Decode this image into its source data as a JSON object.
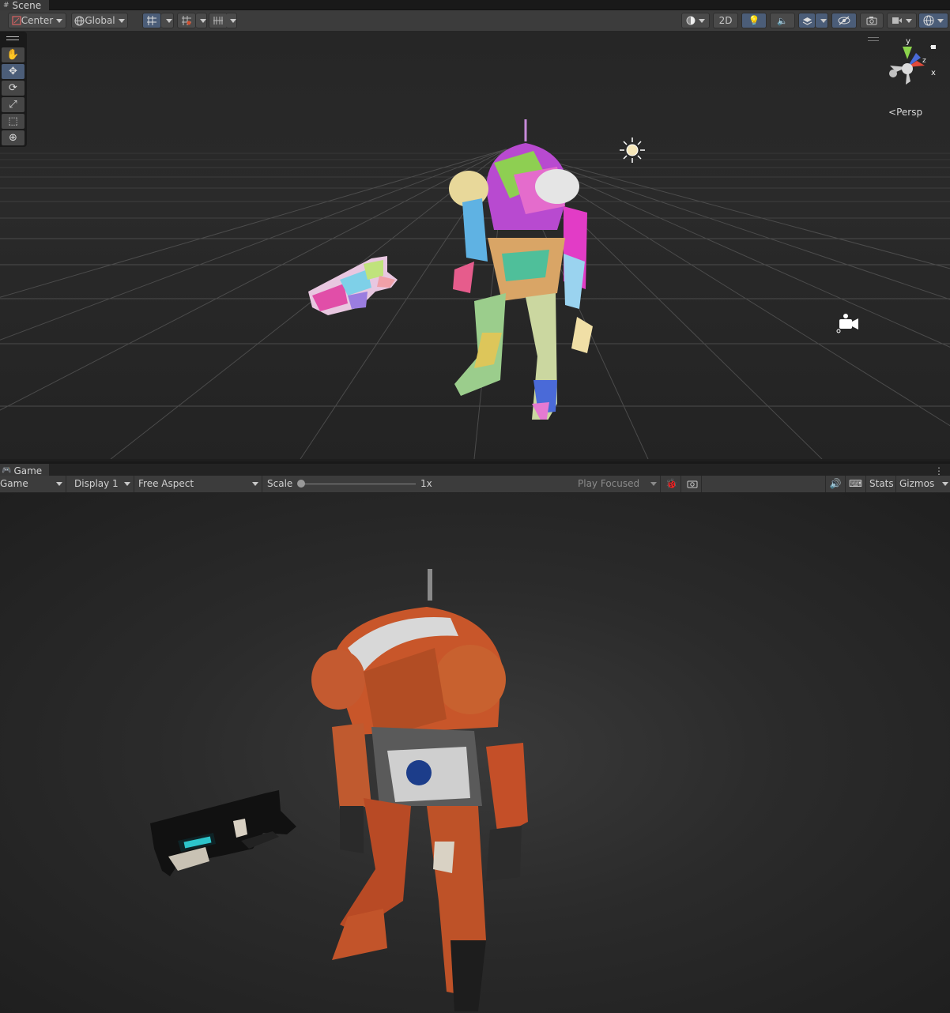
{
  "scene": {
    "tab_label": "Scene",
    "pivot_mode": "Center",
    "pivot_rotation": "Global",
    "btn_2d": "2D",
    "persp_label": "Persp",
    "gizmo_axes": {
      "y": "y",
      "x": "x",
      "z": "z"
    },
    "tools": [
      "hand-tool",
      "move-tool",
      "rotate-tool",
      "scale-tool",
      "rect-tool",
      "transform-tool"
    ]
  },
  "game": {
    "tab_label": "Game",
    "mode_select": "Game",
    "display_select": "Display 1",
    "aspect_select": "Free Aspect",
    "scale_label": "Scale",
    "scale_value": "1x",
    "play_mode": "Play Focused",
    "stats_label": "Stats",
    "gizmos_label": "Gizmos"
  },
  "colors": {
    "accent_active": "#4b5d78",
    "robot_orange": "#c8562a",
    "gun_glow": "#32e0e8"
  }
}
